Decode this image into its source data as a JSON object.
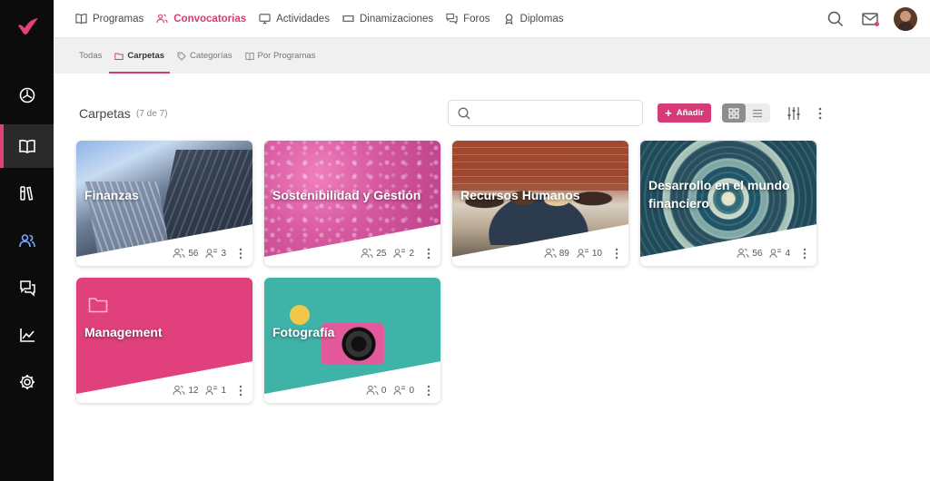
{
  "nav": {
    "items": [
      {
        "label": "Programas",
        "icon": "book-icon",
        "active": false
      },
      {
        "label": "Convocatorias",
        "icon": "users-icon",
        "active": true
      },
      {
        "label": "Actividades",
        "icon": "monitor-icon",
        "active": false
      },
      {
        "label": "Dinamizaciones",
        "icon": "ticket-icon",
        "active": false
      },
      {
        "label": "Foros",
        "icon": "chat-icon",
        "active": false
      },
      {
        "label": "Diplomas",
        "icon": "award-icon",
        "active": false
      }
    ]
  },
  "subnav": {
    "items": [
      {
        "label": "Todas",
        "active": false
      },
      {
        "label": "Carpetas",
        "active": true
      },
      {
        "label": "Categorías",
        "active": false
      },
      {
        "label": "Por Programas",
        "active": false
      }
    ]
  },
  "header": {
    "title": "Carpetas",
    "count": "(7 de 7)",
    "search_placeholder": "",
    "add_label": "Añadir"
  },
  "cards": [
    {
      "title": "Finanzas",
      "users": "56",
      "groups": "3"
    },
    {
      "title": "Sostenibilidad y Gestión",
      "users": "25",
      "groups": "2"
    },
    {
      "title": "Recursos Humanos",
      "users": "89",
      "groups": "10"
    },
    {
      "title": "Desarrollo en el mundo financiero",
      "users": "56",
      "groups": "4"
    },
    {
      "title": "Management",
      "users": "12",
      "groups": "1"
    },
    {
      "title": "Fotografía",
      "users": "0",
      "groups": "0"
    }
  ],
  "colors": {
    "accent": "#d63b78",
    "sidebar": "#0c0c0c",
    "management_card": "#e0407b"
  }
}
